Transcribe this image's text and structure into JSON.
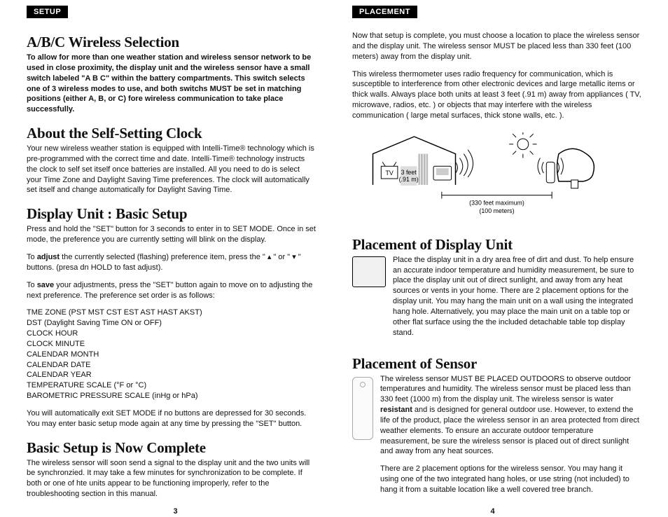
{
  "left": {
    "tab": "SETUP",
    "h1": "A/B/C Wireless Selection",
    "p1": "To allow for more than one weather station and wireless sensor network to be used in close proximity, the display unit and the wireless sensor have a small switch labeled \"A B C\" within the battery compartments. This switch selects one of 3 wireless modes to use, and both switchs MUST be set in matching positions (either A, B, or C) fore wireless communication to take place successfully.",
    "h2": "About the Self-Setting Clock",
    "p2": "Your new wireless weather station is equipped with Intelli-Time® technology which is pre-programmed with the correct time and date. Intelli-Time® technology instructs the clock to self set itself once batteries are installed. All you need to do is select your Time Zone and Daylight Saving Time preferences. The clock will automatically set itself and change automatically for Daylight Saving Time.",
    "h3": "Display Unit : Basic Setup",
    "p3": "Press and hold the \"SET\" button for 3 seconds to enter in to SET MODE. Once in set mode, the preference you are currently setting will blink on the display.",
    "p4a": "To ",
    "p4b": "adjust",
    "p4c": " the currently selected (flashing) preference item, press the   \" ▴ \" or \" ▾ \" buttons. (presa dn HOLD to fast adjust).",
    "p5a": "To ",
    "p5b": "save",
    "p5c": " your adjustments, press the \"SET\" button again to move on to adjusting the next preference. The preference set order is as follows:",
    "list": "TME ZONE (PST MST CST EST AST HAST AKST)\nDST (Daylight Saving Time ON or OFF)\nCLOCK HOUR\nCLOCK MINUTE\nCALENDAR MONTH\nCALENDAR DATE\nCALENDAR YEAR\nTEMPERATURE SCALE (°F or °C)\nBAROMETRIC PRESSURE SCALE (inHg or hPa)",
    "p6": "You will automatically exit SET MODE if no buttons are depressed for 30 seconds.  You may enter basic setup mode again at any time by pressing the \"SET\" button.",
    "h4": "Basic Setup is Now Complete",
    "p7": "The wireless sensor will soon send a signal to the display unit and the two units will be synchronzied. It may take a few minutes for synchronization to be complete. If both or one of hte units appear to be functioning improperly, refer to the troubleshooting section in this manual.",
    "page": "3"
  },
  "right": {
    "tab": "PLACEMENT",
    "p1": "Now that setup is complete, you must choose a location to place the wireless sensor and the display unit. The wireless sensor MUST be placed less than 330 feet (100 meters) away from the display unit.",
    "p2": "This wireless thermometer uses radio frequency for communication, which is susceptible to interference from other electronic devices and large metallic items or thick walls. Always place both units at least 3 feet (.91 m) away from appliances ( TV, microwave, radios, etc. )  or objects that may interfere with the wireless communication ( large metal surfaces, thick stone walls, etc. ).",
    "diag_tv": "TV",
    "diag_3ft": "3 feet",
    "diag_91m": "(.91 m)",
    "diag_330": "(330 feet maximum)",
    "diag_100": "(100 meters)",
    "h1": "Placement of Display Unit",
    "p3": "Place the display unit in a dry area free of dirt and dust. To help ensure an accurate indoor temperature and humidity measurement, be sure to place the display unit out of direct sunlight, and away from any heat sources or vents in your home. There are 2 placement options for the display unit. You may hang the main unit on a wall using the integrated hang hole. Alternatively, you may place the main unit on a table top or other flat surface using the the included detachable table top display stand.",
    "h2": "Placement of Sensor",
    "p4a": "The wireless sensor MUST BE PLACED OUTDOORS to observe outdoor temperatures and humidity. The wireless sensor must be placed less than 330 feet (1000 m) from the display unit. The wireless sensor is water ",
    "p4b": "resistant",
    "p4c": " and is designed for general outdoor use. However, to extend the life of the product, place the wireless sensor in an area protected from direct weather elements. To ensure an accurate outdoor temperature measurement, be sure the wireless sensor is placed out of direct sunlight and away from any heat sources.",
    "p5": "There are 2 placement options for the wireless sensor. You may hang it using one of the two integrated hang holes, or use string (not included) to hang it from a suitable location like a well covered tree branch.",
    "page": "4"
  }
}
